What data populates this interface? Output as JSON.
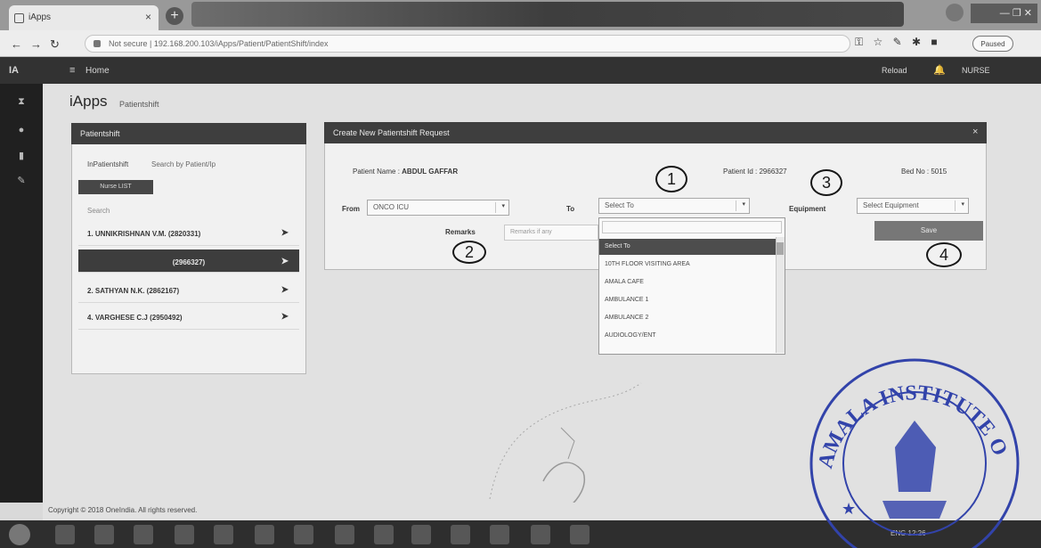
{
  "browser": {
    "tab_title": "iApps",
    "tab_close": "×",
    "new_tab": "+",
    "url": "Not secure | 192.168.200.103/iApps/Patient/PatientShift/index",
    "paused": "Paused",
    "window_controls": "— ❐ ✕"
  },
  "app": {
    "brand": "IA",
    "menu_icon": "≡",
    "home": "Home",
    "reload": "Reload",
    "notifications": "🔔",
    "user": "NURSE"
  },
  "page": {
    "title": "iApps",
    "subtitle": "Patientshift"
  },
  "left_panel": {
    "header": "Patientshift",
    "tabs": [
      "InPatientshift",
      "Search by Patient/Ip"
    ],
    "list_button": "Nurse LIST",
    "search_label": "Search",
    "patients": [
      {
        "label": "1. UNNIKRISHNAN V.M. (2820331)",
        "selected": false
      },
      {
        "label": "(2966327)",
        "selected": true
      },
      {
        "label": "2. SATHYAN N.K. (2862167)",
        "selected": false
      },
      {
        "label": "4. VARGHESE C.J (2950492)",
        "selected": false
      }
    ]
  },
  "right_panel": {
    "header": "Create New Patientshift Request",
    "close": "×",
    "patient_name_label": "Patient Name : ",
    "patient_name": "ABDUL GAFFAR",
    "patient_id_label": "Patient Id : ",
    "patient_id": "2966327",
    "bed_label": "Bed No : ",
    "bed_no": "5015",
    "from_label": "From",
    "from_value": "ONCO ICU",
    "to_label": "To",
    "to_placeholder": "Select To",
    "equipment_label": "Equipment",
    "equipment_placeholder": "Select Equipment",
    "remarks_label": "Remarks",
    "remarks_placeholder": "Remarks if any",
    "save": "Save"
  },
  "dropdown": {
    "options": [
      "Select To",
      "10TH FLOOR VISITING AREA",
      "AMALA CAFE",
      "AMBULANCE 1",
      "AMBULANCE 2",
      "AUDIOLOGY/ENT"
    ],
    "highlighted_index": 0
  },
  "annotations": [
    "1",
    "2",
    "3",
    "4"
  ],
  "footer": {
    "copyright": "Copyright © 2018 OneIndia. All rights reserved."
  },
  "stamp": {
    "text": "AMALA INSTITUTE OF MEDICAL SCIENCES"
  },
  "taskbar": {
    "tray": "ENG  12:26"
  }
}
